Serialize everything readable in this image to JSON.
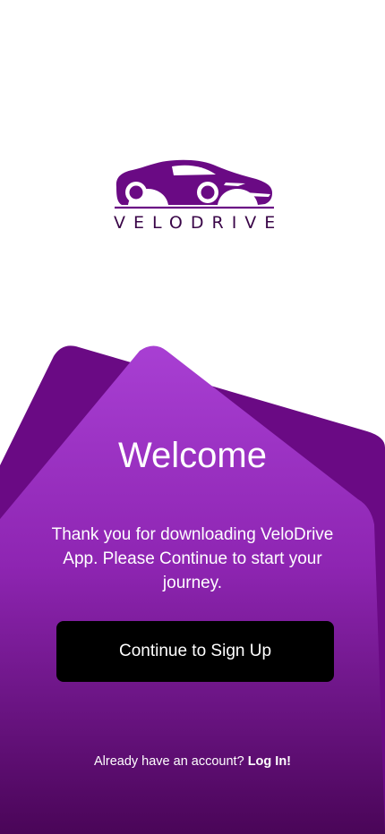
{
  "app": {
    "brand_name": "VELODRIVE",
    "logo_icon": "sports-car-icon"
  },
  "welcome": {
    "title": "Welcome",
    "message": "Thank you for downloading VeloDrive App. Please Continue to start your journey."
  },
  "actions": {
    "continue_label": "Continue to Sign Up",
    "login_prompt": "Already have an account?",
    "login_label": "Log In!"
  },
  "colors": {
    "brand_dark": "#3a0648",
    "brand_purple": "#6a0a84",
    "gradient_top": "#a83fd3",
    "gradient_bottom": "#4a0558",
    "button_bg": "#000000",
    "text_on_purple": "#ffffff"
  }
}
